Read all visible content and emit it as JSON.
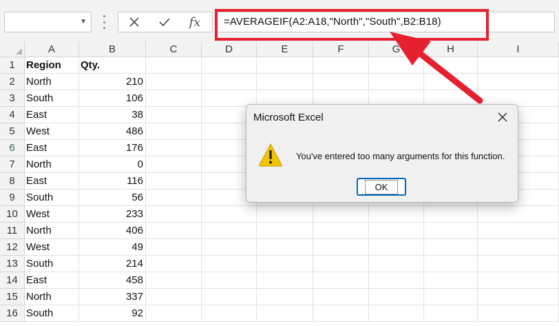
{
  "formula_bar": {
    "name_box_value": "",
    "cancel_icon": "close-icon",
    "enter_icon": "checkmark-icon",
    "insert_function_label": "fx",
    "formula": "=AVERAGEIF(A2:A18,\"North\",\"South\",B2:B18)"
  },
  "columns": [
    "A",
    "B",
    "C",
    "D",
    "E",
    "F",
    "G",
    "H",
    "I"
  ],
  "rows": [
    {
      "num": "1",
      "a": "Region",
      "b": "Qty."
    },
    {
      "num": "2",
      "a": "North",
      "b": "210"
    },
    {
      "num": "3",
      "a": "South",
      "b": "106"
    },
    {
      "num": "4",
      "a": "East",
      "b": "38"
    },
    {
      "num": "5",
      "a": "West",
      "b": "486"
    },
    {
      "num": "6",
      "a": "East",
      "b": "176"
    },
    {
      "num": "7",
      "a": "North",
      "b": "0"
    },
    {
      "num": "8",
      "a": "East",
      "b": "116"
    },
    {
      "num": "9",
      "a": "South",
      "b": "56"
    },
    {
      "num": "10",
      "a": "West",
      "b": "233"
    },
    {
      "num": "11",
      "a": "North",
      "b": "406"
    },
    {
      "num": "12",
      "a": "West",
      "b": "49"
    },
    {
      "num": "13",
      "a": "South",
      "b": "214"
    },
    {
      "num": "14",
      "a": "East",
      "b": "458"
    },
    {
      "num": "15",
      "a": "North",
      "b": "337"
    },
    {
      "num": "16",
      "a": "South",
      "b": "92"
    }
  ],
  "active_row": "6",
  "dialog": {
    "title": "Microsoft Excel",
    "message": "You've entered too many arguments for this function.",
    "ok_label": "OK",
    "icon": "warning-icon",
    "close_icon": "close-icon"
  },
  "colors": {
    "annotation": "#e6202e",
    "warning": "#f5c400",
    "accent": "#0067c0",
    "active_row_header": "#217346"
  }
}
